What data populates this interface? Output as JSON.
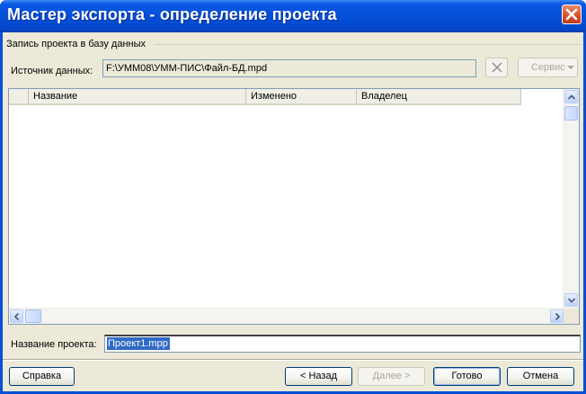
{
  "window": {
    "title": "Мастер экспорта - определение проекта"
  },
  "group": {
    "label": "Запись проекта в базу данных"
  },
  "source": {
    "label": "Источник данных:",
    "value": "F:\\УММ08\\УММ-ПИС\\Файл-БД.mpd",
    "service_label": "Сервис"
  },
  "list": {
    "columns": [
      "Название",
      "Изменено",
      "Владелец"
    ],
    "rows": []
  },
  "project": {
    "label": "Название проекта:",
    "value": "Проект1.mpp"
  },
  "buttons": {
    "help": "Справка",
    "back": "< Назад",
    "next": "Далее >",
    "finish": "Готово",
    "cancel": "Отмена"
  },
  "colors": {
    "title_bar": "#0550d9",
    "close_button": "#d9522b",
    "dialog_background": "#ece9d8",
    "selection": "#316ac5"
  }
}
